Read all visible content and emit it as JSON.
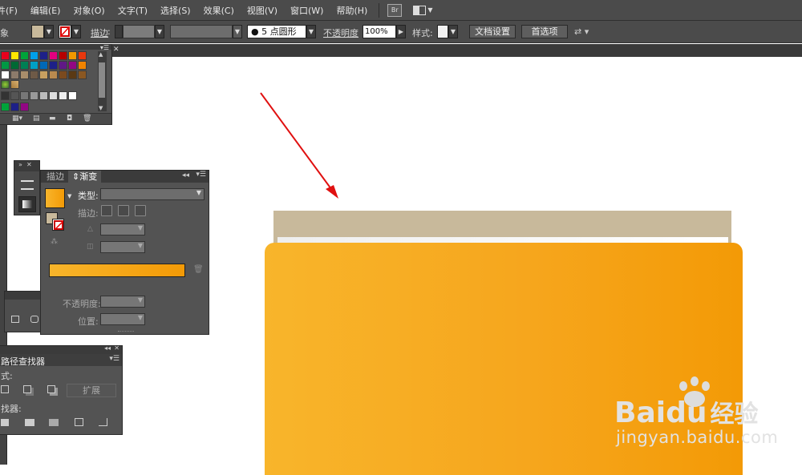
{
  "menu": [
    "件(F)",
    "编辑(E)",
    "对象(O)",
    "文字(T)",
    "选择(S)",
    "效果(C)",
    "视图(V)",
    "窗口(W)",
    "帮助(H)"
  ],
  "bridge_label": "Br",
  "control_bar": {
    "object_label": "象",
    "stroke_label": "描边",
    "stroke_colon": ":",
    "brush_label": "5 点圆形",
    "opacity_label": "不透明度",
    "opacity_value": "100%",
    "style_label": "样式:",
    "doc_setup": "文档设置",
    "prefs": "首选项"
  },
  "swatches": {
    "colors_row1": [
      "#e8001d",
      "#ffe600",
      "#00a33a",
      "#00a0e9",
      "#1d2088",
      "#e4007f",
      "#b50000",
      "#f39800",
      "#e8380d"
    ],
    "colors_row2": [
      "#009944",
      "#006934",
      "#007f54",
      "#00a0c6",
      "#0068b7",
      "#1d2088",
      "#601986",
      "#920783",
      "#f08300"
    ],
    "colors_row3": [
      "#ffffff",
      "#8c7b6b",
      "#a88d6b",
      "#6e5a47",
      "#c8a060",
      "#b98a4f",
      "#7b4a1e",
      "#5a3914",
      "#8a5722"
    ],
    "grays": [
      "#333333",
      "#555555",
      "#777777",
      "#999999",
      "#bbbbbb",
      "#dddddd",
      "#eeeeee",
      "#ffffff"
    ],
    "extras": [
      "#00a33a",
      "#1d2088",
      "#920783"
    ]
  },
  "gradient_panel": {
    "tab_stroke": "描边",
    "tab_gradient": "渐变",
    "type_label": "类型",
    "stroke_label": "描边",
    "opacity_label": "不透明度",
    "position_label": "位置",
    "colon": ":"
  },
  "pathfinder": {
    "title": "路径查找器",
    "shape_modes": "式:",
    "pathfinders": "找器:",
    "expand": "扩展"
  },
  "watermark": {
    "brand_a": "Bai",
    "brand_b": "du",
    "brand_cn": "经验",
    "url": "jingyan.baidu.com"
  },
  "colors": {
    "ui_bg": "#535353",
    "accent_orange": "#f7a81e",
    "tan": "#c8b99b"
  }
}
